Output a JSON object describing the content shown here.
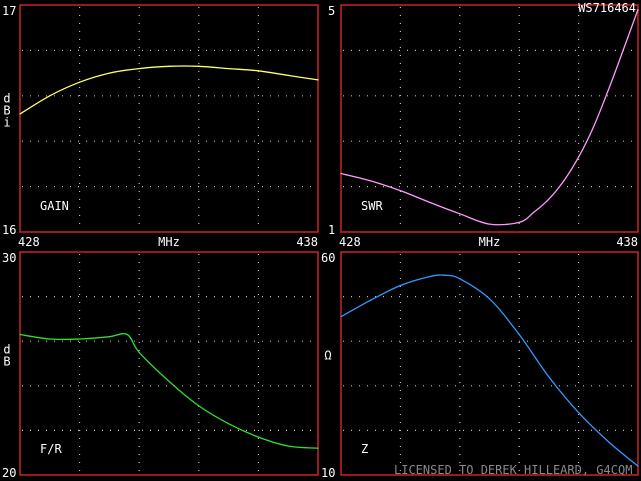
{
  "header": {
    "model_id": "WS716464"
  },
  "footer": {
    "license": "LICENSED TO DEREK HILLEARD, G4CQM"
  },
  "colors": {
    "background": "#000000",
    "frame": "#cc2222",
    "grid": "#bbbbbb",
    "text": "#ffffff",
    "gain": "#ffff66",
    "swr": "#ff99ff",
    "fr": "#33dd33",
    "z": "#3399ff"
  },
  "chart_data": [
    {
      "id": "gain",
      "type": "line",
      "panel_label": "GAIN",
      "ylabel": "dBi",
      "x_tick_labels": [
        "428",
        "MHz",
        "438"
      ],
      "xlim": [
        428,
        438
      ],
      "ylim": [
        16,
        17
      ],
      "y_tick_labels": {
        "top": "17",
        "bottom": "16"
      },
      "grid": true,
      "series": [
        {
          "color_key": "gain",
          "x": [
            428,
            429,
            430,
            431,
            432,
            433,
            434,
            435,
            436,
            437,
            438
          ],
          "y": [
            16.52,
            16.6,
            16.66,
            16.7,
            16.72,
            16.73,
            16.73,
            16.72,
            16.71,
            16.69,
            16.67
          ]
        }
      ]
    },
    {
      "id": "swr",
      "type": "line",
      "panel_label": "SWR",
      "ylabel": "",
      "x_tick_labels": [
        "428",
        "MHz",
        "438"
      ],
      "xlim": [
        428,
        438
      ],
      "ylim": [
        1,
        5
      ],
      "y_tick_labels": {
        "top": "5",
        "bottom": "1"
      },
      "grid": true,
      "series": [
        {
          "color_key": "swr",
          "x": [
            428,
            429,
            430,
            431,
            432,
            433,
            434,
            434.5,
            435,
            435.5,
            436,
            436.5,
            437,
            437.5,
            438
          ],
          "y": [
            2.03,
            1.9,
            1.73,
            1.52,
            1.32,
            1.14,
            1.17,
            1.35,
            1.58,
            1.9,
            2.32,
            2.85,
            3.5,
            4.2,
            4.92
          ]
        }
      ]
    },
    {
      "id": "fr",
      "type": "line",
      "panel_label": "F/R",
      "ylabel": "dB",
      "x_tick_labels": [],
      "xlim": [
        428,
        438
      ],
      "ylim": [
        20,
        30
      ],
      "y_tick_labels": {
        "top": "30",
        "bottom": "20"
      },
      "grid": true,
      "series": [
        {
          "color_key": "fr",
          "x": [
            428,
            429,
            430,
            431,
            431.6,
            432,
            433,
            434,
            435,
            436,
            437,
            438
          ],
          "y": [
            26.3,
            26.1,
            26.1,
            26.2,
            26.3,
            25.5,
            24.2,
            23.1,
            22.3,
            21.7,
            21.3,
            21.2
          ]
        }
      ]
    },
    {
      "id": "z",
      "type": "line",
      "panel_label": "Z",
      "ylabel": "Ω",
      "x_tick_labels": [],
      "xlim": [
        428,
        438
      ],
      "ylim": [
        10,
        60
      ],
      "y_tick_labels": {
        "top": "60",
        "bottom": "10"
      },
      "grid": true,
      "series": [
        {
          "color_key": "z",
          "x": [
            428,
            429,
            430,
            431,
            431.5,
            432,
            433,
            434,
            435,
            436,
            437,
            438
          ],
          "y": [
            45.5,
            49.2,
            52.5,
            54.5,
            54.8,
            54.0,
            49.5,
            41.5,
            32.0,
            24.0,
            17.5,
            12.0
          ]
        }
      ]
    }
  ]
}
